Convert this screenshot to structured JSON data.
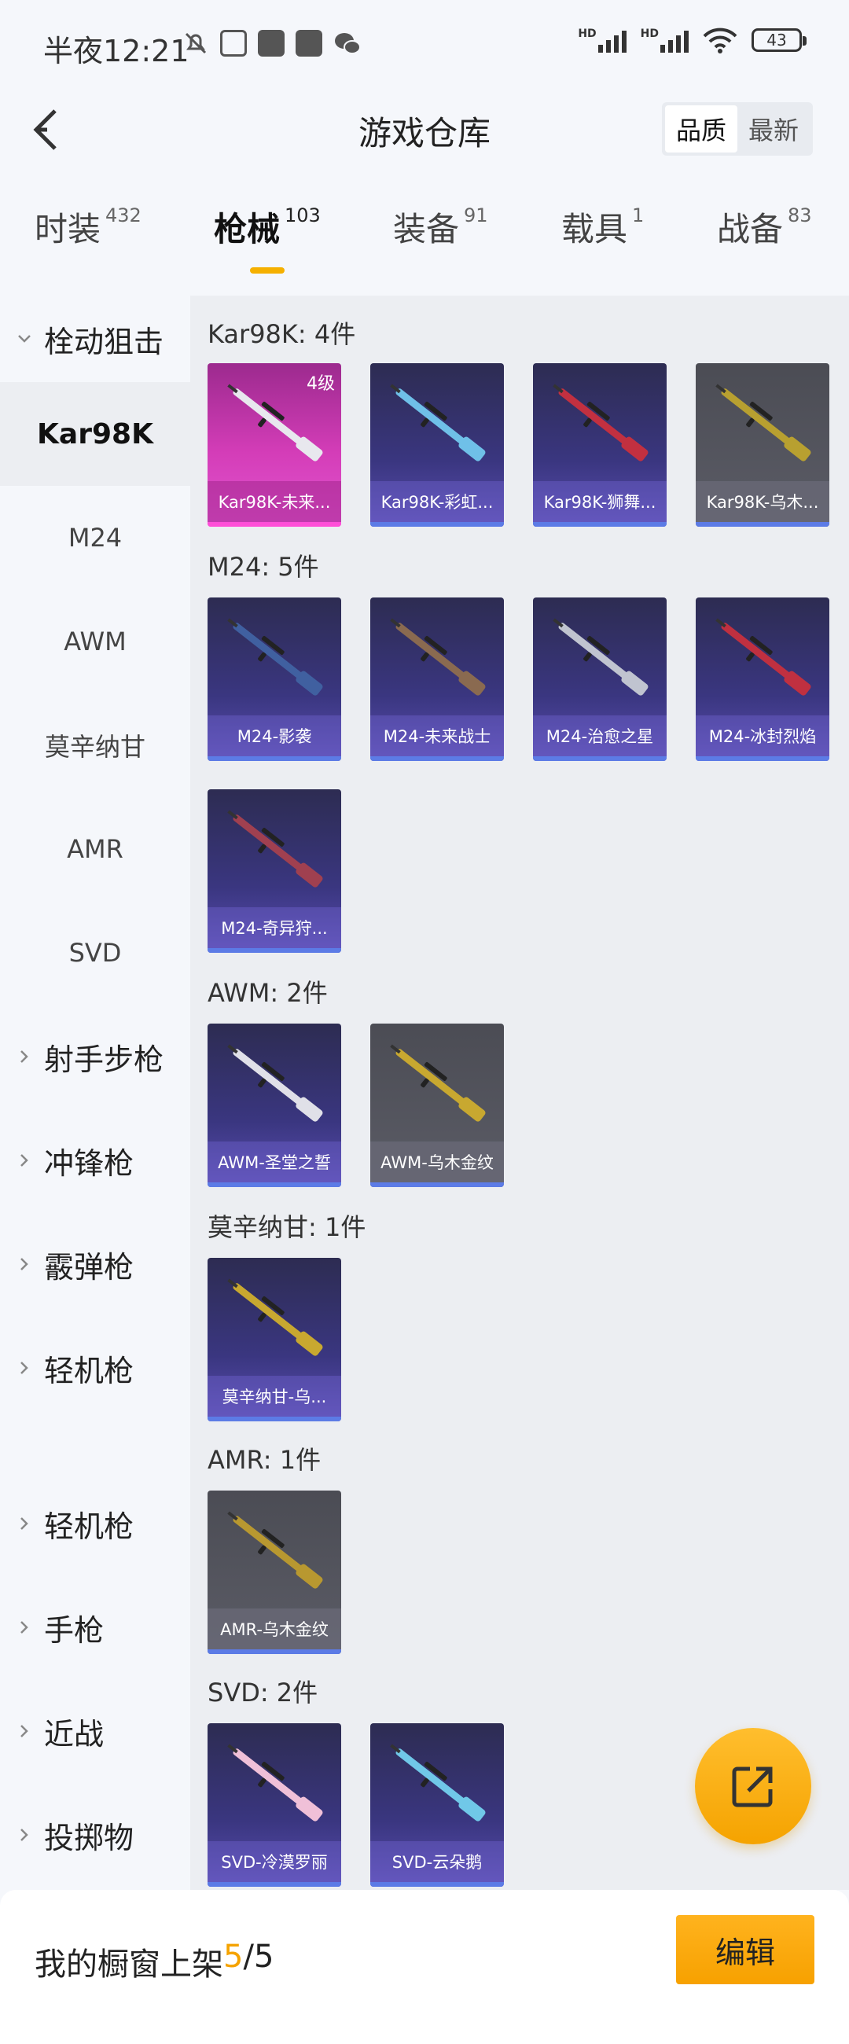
{
  "status_bar": {
    "time": "半夜12:21",
    "battery": "43",
    "hd1": "HD",
    "hd2": "HD"
  },
  "header": {
    "title": "游戏仓库",
    "sort_options": [
      "品质",
      "最新"
    ],
    "sort_active": "品质"
  },
  "tabs": [
    {
      "label": "时装",
      "count": "432"
    },
    {
      "label": "枪械",
      "count": "103",
      "active": true
    },
    {
      "label": "装备",
      "count": "91"
    },
    {
      "label": "载具",
      "count": "1"
    },
    {
      "label": "战备",
      "count": "83"
    }
  ],
  "sidebar": {
    "expanded_category": "栓动狙击",
    "sub_items": [
      "Kar98K",
      "M24",
      "AWM",
      "莫辛纳甘",
      "AMR",
      "SVD"
    ],
    "active_sub": "Kar98K",
    "categories": [
      "射手步枪",
      "冲锋枪",
      "霰弹枪",
      "轻机枪",
      "轻机枪",
      "手枪",
      "近战",
      "投掷物"
    ]
  },
  "sections": [
    {
      "title": "Kar98K: 4件",
      "items": [
        {
          "name": "Kar98K-未来...",
          "style": "pink",
          "level": "4级",
          "gun": "#e8e8ee"
        },
        {
          "name": "Kar98K-彩虹...",
          "style": "purple",
          "gun": "#6fc0e8"
        },
        {
          "name": "Kar98K-狮舞...",
          "style": "purple",
          "gun": "#c23040"
        },
        {
          "name": "Kar98K-乌木...",
          "style": "grey",
          "gun": "#b8a030"
        }
      ]
    },
    {
      "title": "M24: 5件",
      "items": [
        {
          "name": "M24-影袭",
          "style": "purple",
          "gun": "#4060a0"
        },
        {
          "name": "M24-未来战士",
          "style": "purple",
          "gun": "#8a6a50"
        },
        {
          "name": "M24-治愈之星",
          "style": "purple",
          "gun": "#c0c4d0"
        },
        {
          "name": "M24-冰封烈焰",
          "style": "purple",
          "gun": "#c03040"
        },
        {
          "name": "M24-奇异狩...",
          "style": "purple",
          "gun": "#a04050"
        }
      ]
    },
    {
      "title": "AWM: 2件",
      "items": [
        {
          "name": "AWM-圣堂之誓",
          "style": "purple",
          "gun": "#e0e0e8"
        },
        {
          "name": "AWM-乌木金纹",
          "style": "grey",
          "gun": "#c8a830"
        }
      ]
    },
    {
      "title": "莫辛纳甘: 1件",
      "items": [
        {
          "name": "莫辛纳甘-乌...",
          "style": "purple",
          "gun": "#c8a830"
        }
      ]
    },
    {
      "title": "AMR: 1件",
      "items": [
        {
          "name": "AMR-乌木金纹",
          "style": "grey",
          "gun": "#b89830"
        }
      ]
    },
    {
      "title": "SVD: 2件",
      "items": [
        {
          "name": "SVD-冷漠罗丽",
          "style": "purple",
          "gun": "#f0c0d8"
        },
        {
          "name": "SVD-云朵鹅",
          "style": "purple",
          "gun": "#70c8e8"
        }
      ]
    }
  ],
  "bottom_bar": {
    "label": "我的橱窗上架 ",
    "current": "5",
    "sep": "/",
    "total": "5",
    "edit_label": "编辑"
  },
  "icons": {
    "back": "back-arrow-icon",
    "fab": "share-external-icon",
    "expand": "chevron-down-icon",
    "collapse": "chevron-right-icon"
  },
  "colors": {
    "accent": "#f5a300"
  }
}
